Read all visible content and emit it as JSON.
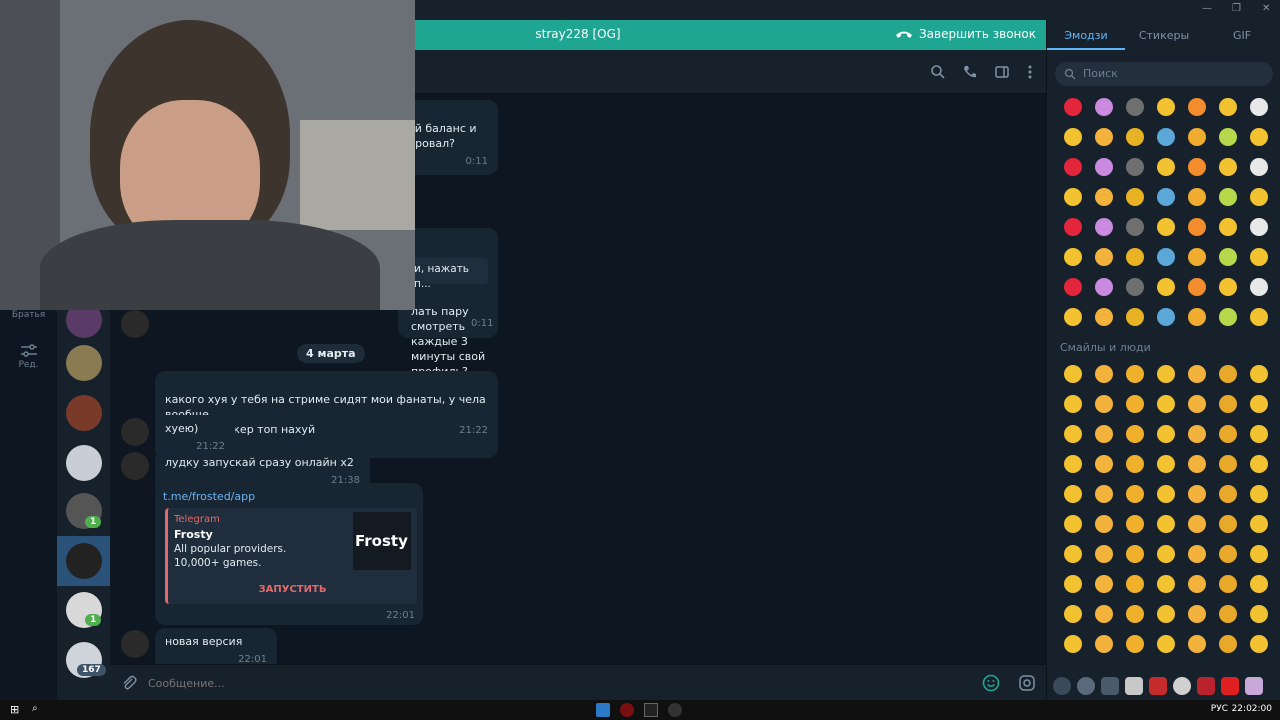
{
  "call": {
    "title": "stray228 [OG]",
    "end_label": "Завершить звонок"
  },
  "folders": [
    {
      "label": "Братья"
    },
    {
      "label": "Ред."
    }
  ],
  "chat_unread": [
    "1",
    "1",
    "167"
  ],
  "messages": [
    {
      "text": "ой баланс и\nировал?",
      "time": "0:11"
    },
    {
      "text": "и, нажать п...",
      "time": ""
    },
    {
      "text": "лать пару\nсмотреть\nкаждые 3 минуты свой профиль?",
      "time": "0:11"
    },
    {
      "text": "какого хуя у тебя на стриме сидят мои фанаты, у чела вообще\nник ньюйоркер топ нахуй",
      "time": "21:22"
    },
    {
      "text": "хуею)",
      "time": "21:22"
    },
    {
      "text": "лудку запускай сразу онлайн х2",
      "time": "21:38"
    },
    {
      "text": "новая версия",
      "time": "22:01"
    }
  ],
  "date_separator": "4 марта",
  "link_preview": {
    "url": "t.me/frosted/app",
    "site": "Telegram",
    "title": "Frosty",
    "description": "All popular providers. 10,000+ games.",
    "image_text": "Frosty",
    "button": "ЗАПУСТИТЬ",
    "time": "22:01"
  },
  "composer": {
    "placeholder": "Сообщение..."
  },
  "emoji_panel": {
    "tabs": [
      "Эмодзи",
      "Стикеры",
      "GIF"
    ],
    "search_placeholder": "Поиск",
    "section": "Смайлы и люди"
  },
  "taskbar": {
    "lang": "РУС",
    "clock": "22:02:00"
  },
  "colors": {
    "accent": "#1ea692",
    "link": "#6ab3f3",
    "preview_accent": "#e26a6a",
    "bg": "#0e1621"
  }
}
